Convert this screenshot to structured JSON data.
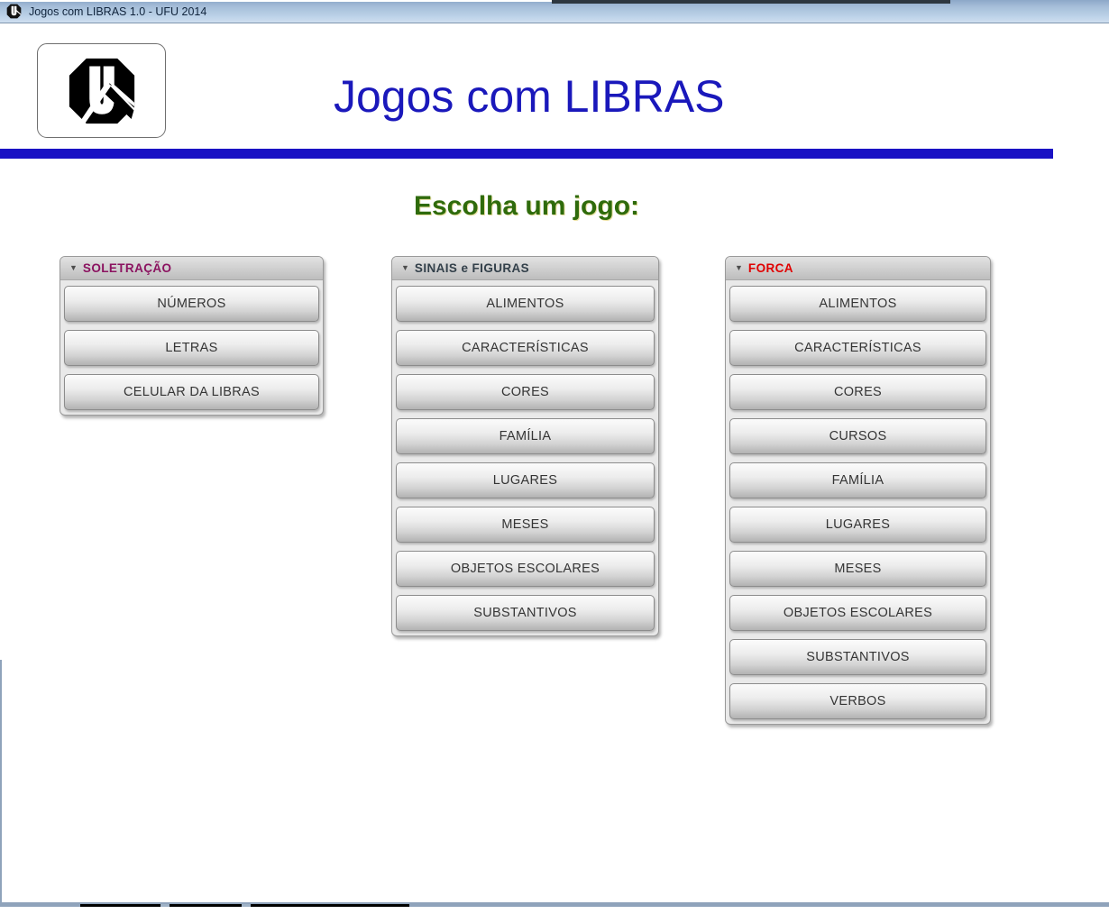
{
  "window": {
    "title": "Jogos com LIBRAS 1.0 - UFU 2014",
    "icon": "ufu-logo-icon"
  },
  "header": {
    "logo_icon": "ufu-logo-icon",
    "app_title": "Jogos com LIBRAS",
    "title_color": "#1a18bb",
    "rule_color": "#1a12c4"
  },
  "main": {
    "section_title": "Escolha um jogo:",
    "section_title_color": "#2f6b0c",
    "panels": [
      {
        "caret": "▼",
        "title": "SOLETRAÇÃO",
        "title_color": "#8b1360",
        "buttons": [
          "NÚMEROS",
          "LETRAS",
          "CELULAR DA LIBRAS"
        ]
      },
      {
        "caret": "▼",
        "title": "SINAIS e FIGURAS",
        "title_color": "#33404a",
        "buttons": [
          "ALIMENTOS",
          "CARACTERÍSTICAS",
          "CORES",
          "FAMÍLIA",
          "LUGARES",
          "MESES",
          "OBJETOS ESCOLARES",
          "SUBSTANTIVOS"
        ]
      },
      {
        "caret": "▼",
        "title": "FORCA",
        "title_color": "#e00000",
        "buttons": [
          "ALIMENTOS",
          "CARACTERÍSTICAS",
          "CORES",
          "CURSOS",
          "FAMÍLIA",
          "LUGARES",
          "MESES",
          "OBJETOS ESCOLARES",
          "SUBSTANTIVOS",
          "VERBOS"
        ]
      }
    ]
  }
}
